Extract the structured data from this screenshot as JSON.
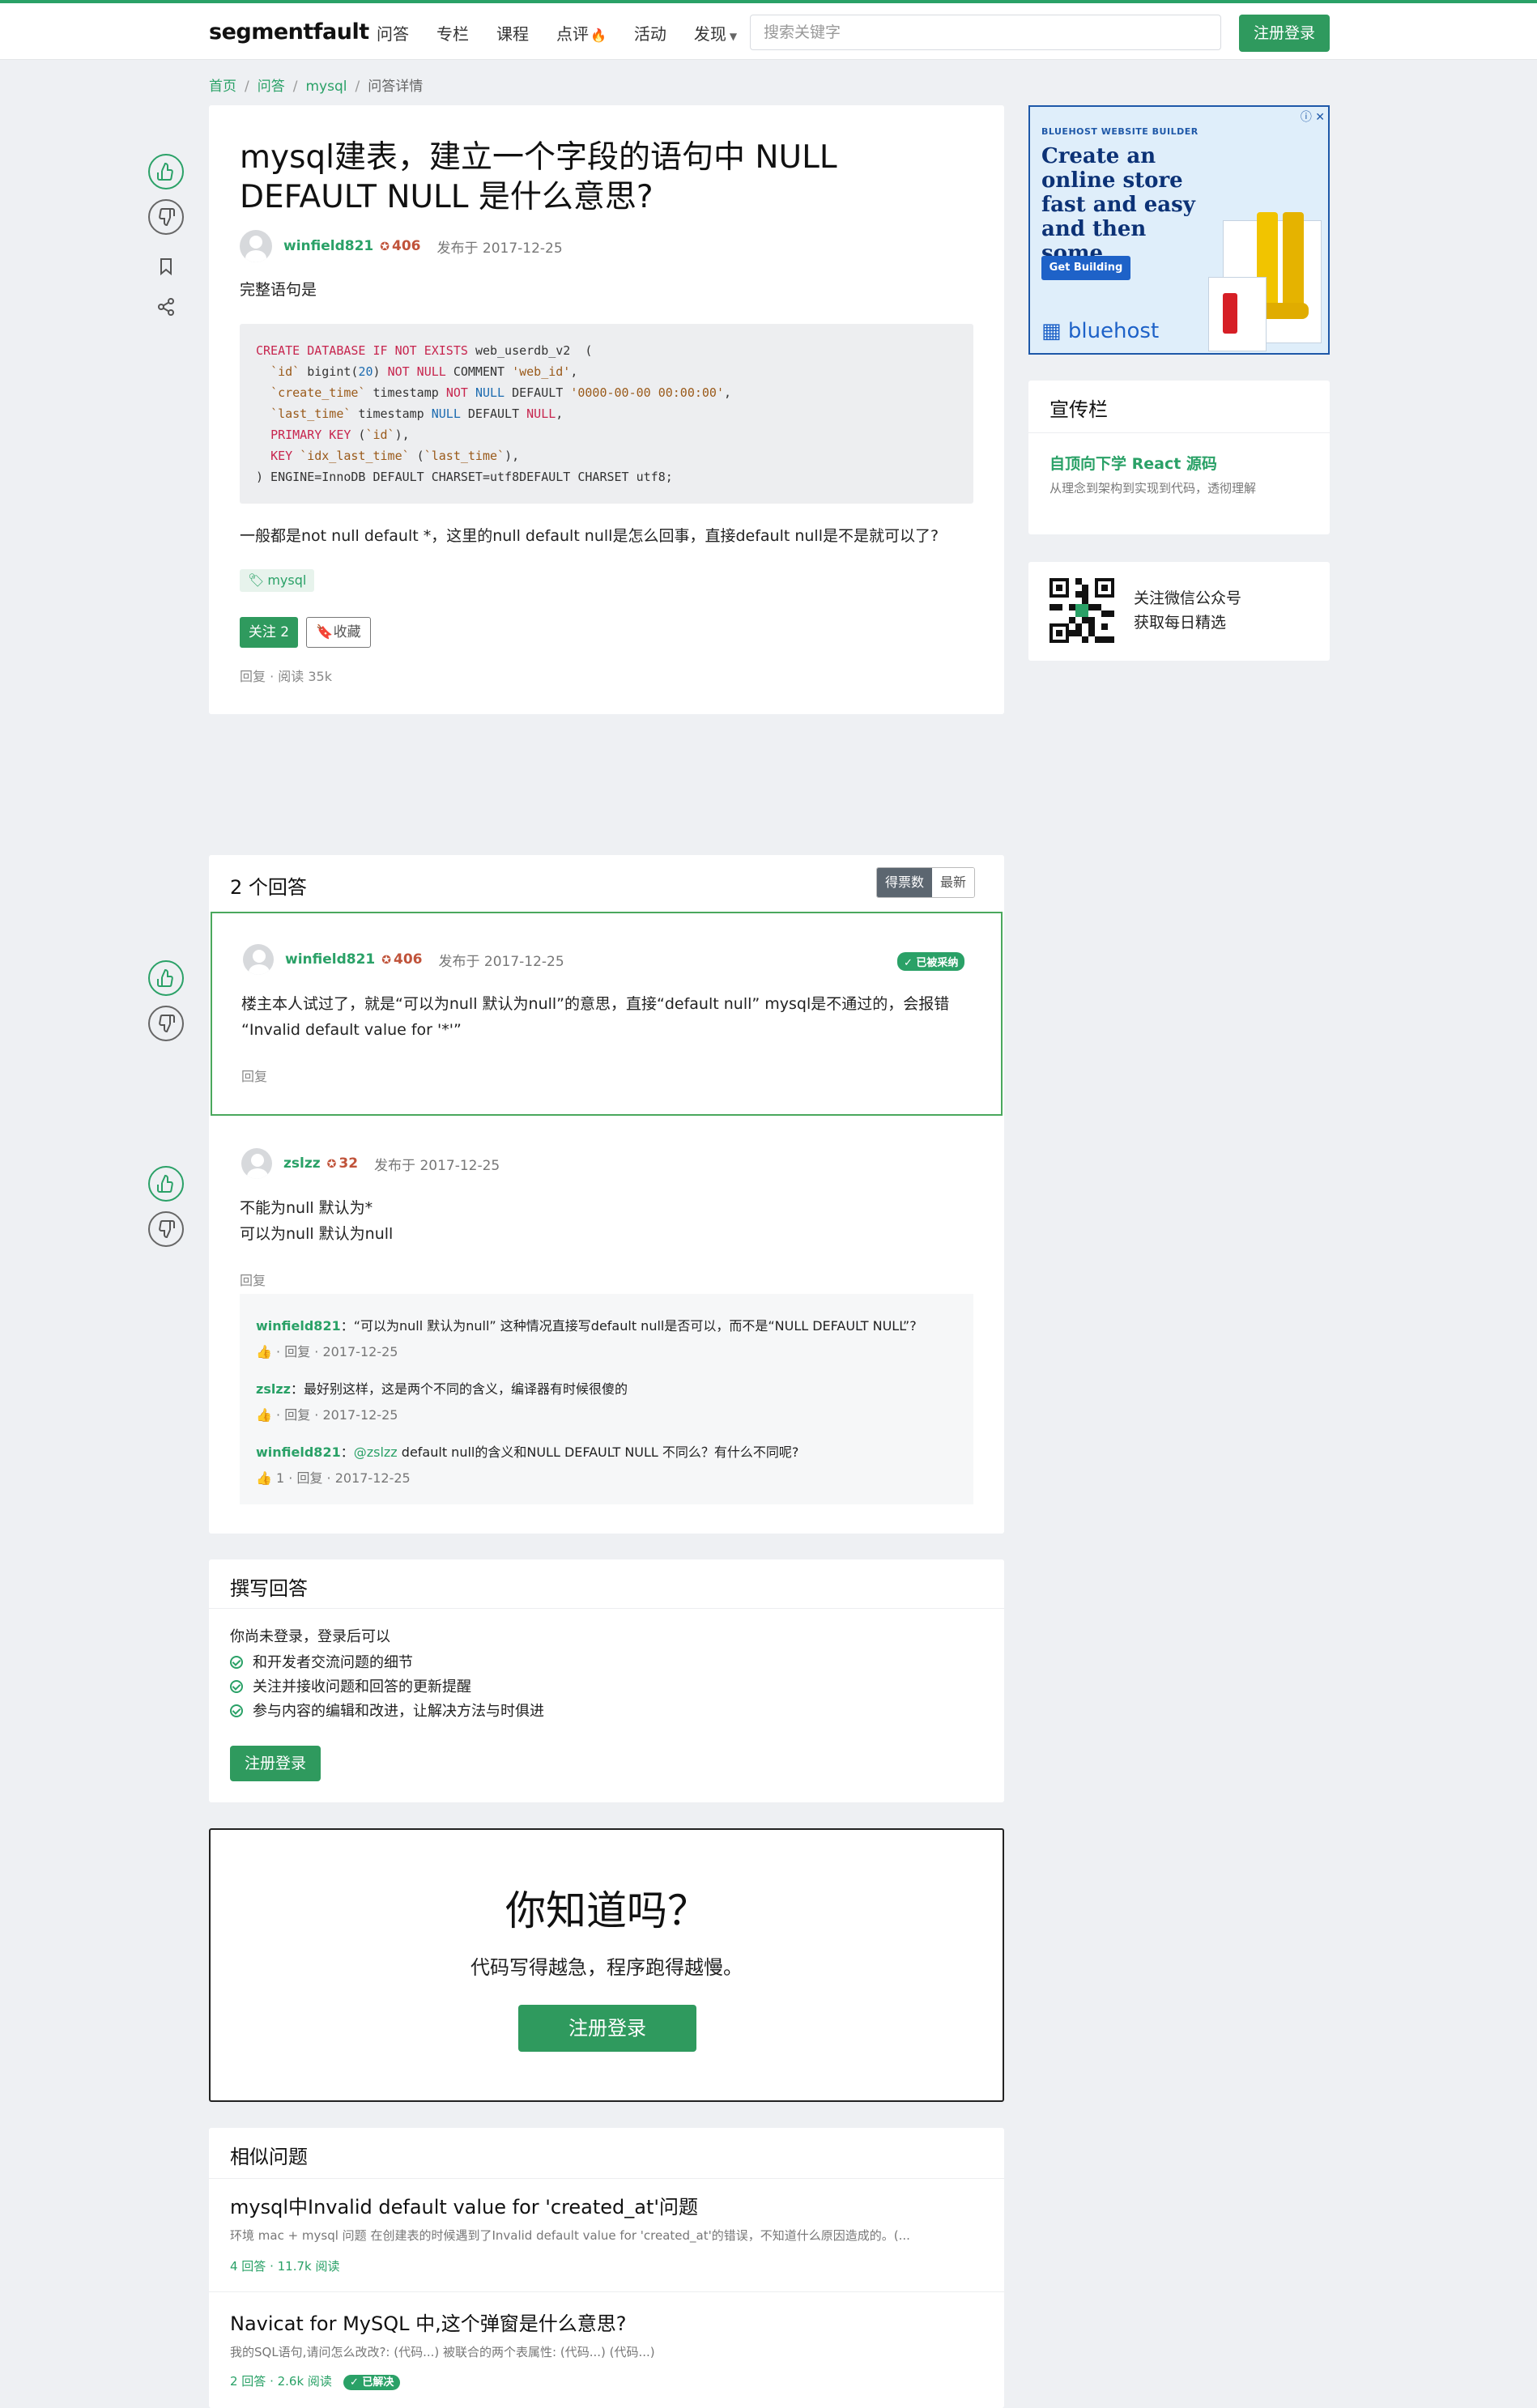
{
  "header": {
    "logo_a": "segment",
    "logo_b": "fault",
    "nav": [
      "问答",
      "专栏",
      "课程",
      "点评",
      "活动",
      "发现"
    ],
    "search_placeholder": "搜索关键字",
    "login": "注册登录"
  },
  "breadcrumb": [
    "首页",
    "问答",
    "mysql",
    "问答详情"
  ],
  "question": {
    "title": "mysql建表，建立一个字段的语句中 NULL DEFAULT NULL 是什么意思?",
    "author": "winfield821",
    "rep": "406",
    "published": "发布于 2017-12-25",
    "intro": "完整语句是",
    "code_lines": [
      "CREATE DATABASE IF NOT EXISTS web_userdb_v2  (",
      "  `id` bigint(20) NOT NULL COMMENT 'web_id',",
      "  `create_time` timestamp NOT NULL DEFAULT '0000-00-00 00:00:00',",
      "  `last_time` timestamp NULL DEFAULT NULL,",
      "  PRIMARY KEY (`id`),",
      "  KEY `idx_last_time` (`last_time`),",
      ") ENGINE=InnoDB DEFAULT CHARSET=utf8DEFAULT CHARSET utf8;"
    ],
    "body": "一般都是not null default *，这里的null default null是怎么回事，直接default null是不是就可以了?",
    "tag": "mysql",
    "follow": "关注 2",
    "collect": "收藏",
    "meta": "回复 · 阅读 35k"
  },
  "answers_section": {
    "title": "2 个回答",
    "sort_tabs": [
      "得票数",
      "最新"
    ]
  },
  "answers": [
    {
      "author": "winfield821",
      "rep": "406",
      "published": "发布于 2017-12-25",
      "accepted": "✓ 已被采纳",
      "body_line1": "楼主本人试过了，就是“可以为null 默认为null”的意思，直接“default null” mysql是不通过的，会报错",
      "body_line2": "“Invalid default value for '*'”",
      "reply": "回复"
    },
    {
      "author": "zslzz",
      "rep": "32",
      "published": "发布于 2017-12-25",
      "body_line1": "不能为null 默认为*",
      "body_line2": "可以为null 默认为null",
      "reply": "回复",
      "comments": [
        {
          "user": "winfield821",
          "mention": "",
          "text": "：“可以为null 默认为null” 这种情况直接写default null是否可以，而不是“NULL DEFAULT NULL”?",
          "meta": "· 回复 · 2017-12-25"
        },
        {
          "user": "zslzz",
          "mention": "",
          "text": "：最好别这样，这是两个不同的含义，编译器有时候很傻的",
          "meta": "· 回复 · 2017-12-25"
        },
        {
          "user": "winfield821",
          "mention": "@zslzz",
          "text": " default null的含义和NULL DEFAULT NULL 不同么？有什么不同呢?",
          "meta": "1 · 回复 · 2017-12-25"
        }
      ]
    }
  ],
  "write_answer": {
    "title": "撰写回答",
    "intro": "你尚未登录，登录后可以",
    "items": [
      "和开发者交流问题的细节",
      "关注并接收问题和回答的更新提醒",
      "参与内容的编辑和改进，让解决方法与时俱进"
    ],
    "button": "注册登录"
  },
  "did_you_know": {
    "title": "你知道吗？",
    "subtitle": "代码写得越急，程序跑得越慢。",
    "button": "注册登录"
  },
  "similar": {
    "title": "相似问题",
    "items": [
      {
        "title": "mysql中Invalid default value for 'created_at'问题",
        "desc": "环境 mac + mysql 问题 在创建表的时候遇到了Invalid default value for 'created_at'的错误，不知道什么原因造成的。(...",
        "meta": "4 回答 · 11.7k 阅读",
        "solved": ""
      },
      {
        "title": "Navicat for MySQL 中,这个弹窗是什么意思?",
        "desc": "我的SQL语句,请问怎么改改?: (代码...) 被联合的两个表属性: (代码...) (代码...)",
        "meta": "2 回答 · 2.6k 阅读",
        "solved": "✓ 已解决"
      }
    ]
  },
  "ad": {
    "kicker": "BLUEHOST WEBSITE BUILDER",
    "headline": "Create an online store fast and easy and then some.",
    "cta": "Get Building",
    "brand": "bluehost"
  },
  "sidebar": {
    "promo_title": "宣传栏",
    "promo_link": "自顶向下学 React 源码",
    "promo_desc": "从理念到架构到实现到代码，透彻理解",
    "wechat_line1": "关注微信公众号",
    "wechat_line2": "获取每日精选"
  },
  "colors": {
    "brand_green": "#2aa167",
    "button_green": "#2f9a5e"
  }
}
